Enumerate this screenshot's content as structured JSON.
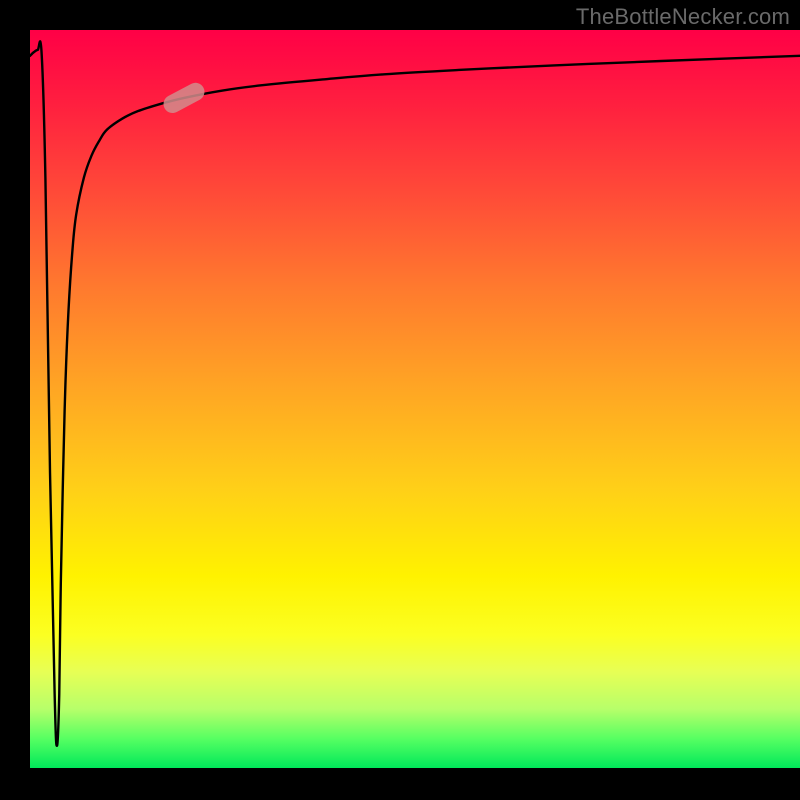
{
  "watermark": "TheBottleNecker.com",
  "chart_data": {
    "type": "line",
    "title": "",
    "xlabel": "",
    "ylabel": "",
    "xlim": [
      0,
      100
    ],
    "ylim": [
      0,
      100
    ],
    "background": {
      "type": "vertical_gradient",
      "stops": [
        {
          "pos": 0.0,
          "color": "#ff0046"
        },
        {
          "pos": 0.5,
          "color": "#ffa424"
        },
        {
          "pos": 0.78,
          "color": "#fff200"
        },
        {
          "pos": 1.0,
          "color": "#00e85a"
        }
      ]
    },
    "series": [
      {
        "name": "bottleneck_curve",
        "x": [
          0.0,
          0.5,
          1.0,
          1.5,
          2.0,
          2.6,
          3.2,
          3.5,
          3.8,
          4.0,
          4.3,
          4.6,
          5.0,
          5.5,
          6.0,
          7.0,
          8.0,
          9.0,
          10.0,
          12.0,
          14.0,
          17.0,
          20.0,
          25.0,
          30.0,
          38.0,
          46.0,
          56.0,
          68.0,
          82.0,
          100.0
        ],
        "y": [
          96.5,
          97.0,
          97.3,
          97.0,
          80.0,
          40.0,
          10.0,
          3.0,
          10.0,
          25.0,
          40.0,
          52.0,
          62.0,
          70.0,
          75.0,
          80.0,
          83.0,
          85.0,
          86.5,
          88.0,
          89.0,
          90.0,
          90.8,
          91.8,
          92.5,
          93.3,
          94.0,
          94.6,
          95.2,
          95.8,
          96.5
        ]
      }
    ],
    "marker": {
      "x": 20.0,
      "y": 90.8,
      "type": "pill",
      "angle_deg": 28
    },
    "axes_visible": false,
    "grid": false
  }
}
